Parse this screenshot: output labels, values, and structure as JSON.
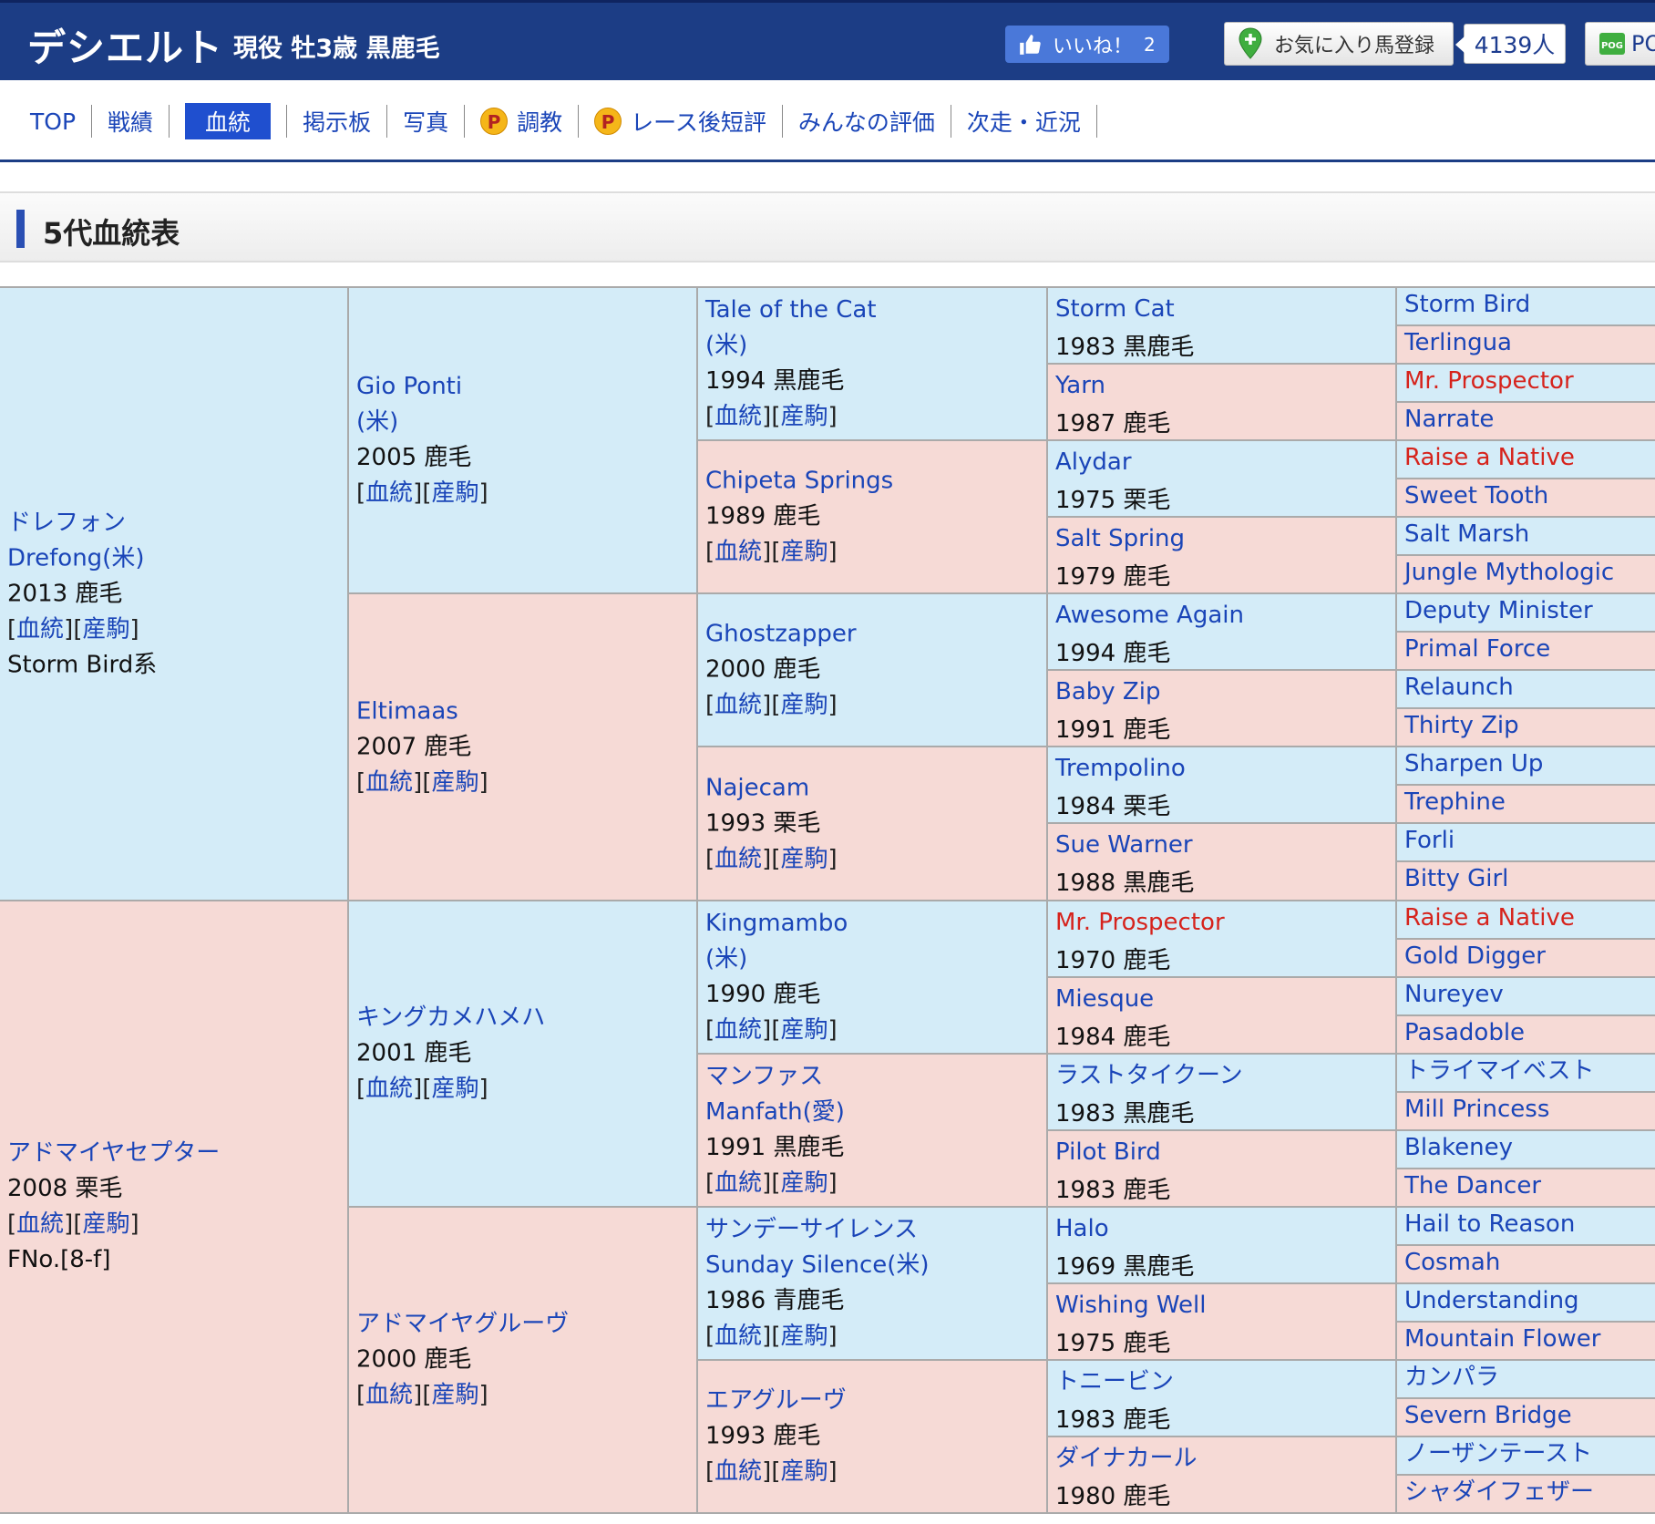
{
  "header": {
    "horse_name": "デシエルト",
    "horse_info": "現役 牡3歳 黒鹿毛",
    "like_label": "いいね！",
    "like_count": "2",
    "favorite_label": "お気に入り馬登録",
    "favorite_count": "4139人",
    "pog_label": "PO"
  },
  "nav": {
    "items": [
      {
        "label": "TOP"
      },
      {
        "label": "戦績"
      },
      {
        "label": "血統"
      },
      {
        "label": "掲示板"
      },
      {
        "label": "写真"
      },
      {
        "label": "調教",
        "p_icon": "P"
      },
      {
        "label": "レース後短評",
        "p_icon": "P"
      },
      {
        "label": "みんなの評価"
      },
      {
        "label": "次走・近況"
      }
    ]
  },
  "section": {
    "title": "5代血統表"
  },
  "link_labels": {
    "pedigree": "血統",
    "offspring": "産駒"
  },
  "pedigree": {
    "g1": [
      {
        "name": "ドレフォン",
        "name2": "Drefong(米)",
        "info": "2013 鹿毛",
        "extra": "Storm Bird系",
        "sex": "male"
      },
      {
        "name": "アドマイヤセプター",
        "info": "2008 栗毛",
        "extra": "FNo.[8-f]",
        "sex": "female"
      }
    ],
    "g2": [
      {
        "name": "Gio Ponti",
        "name2": "(米)",
        "info": "2005 鹿毛",
        "sex": "male"
      },
      {
        "name": "Eltimaas",
        "info": "2007 鹿毛",
        "sex": "female"
      },
      {
        "name": "キングカメハメハ",
        "info": "2001 鹿毛",
        "sex": "male"
      },
      {
        "name": "アドマイヤグルーヴ",
        "info": "2000 鹿毛",
        "sex": "female"
      }
    ],
    "g3": [
      {
        "name": "Tale of the Cat",
        "name2": "(米)",
        "info": "1994 黒鹿毛",
        "sex": "male"
      },
      {
        "name": "Chipeta Springs",
        "info": "1989 鹿毛",
        "sex": "female"
      },
      {
        "name": "Ghostzapper",
        "info": "2000 鹿毛",
        "sex": "male"
      },
      {
        "name": "Najecam",
        "info": "1993 栗毛",
        "sex": "female"
      },
      {
        "name": "Kingmambo",
        "name2": "(米)",
        "info": "1990 鹿毛",
        "sex": "male"
      },
      {
        "name": "マンファス",
        "name2": "Manfath(愛)",
        "info": "1991 黒鹿毛",
        "sex": "female"
      },
      {
        "name": "サンデーサイレンス",
        "name2": "Sunday Silence(米)",
        "info": "1986 青鹿毛",
        "sex": "male"
      },
      {
        "name": "エアグルーヴ",
        "info": "1993 鹿毛",
        "sex": "female"
      }
    ],
    "g4": [
      {
        "name": "Storm Cat",
        "info": "1983 黒鹿毛",
        "sex": "male"
      },
      {
        "name": "Yarn",
        "info": "1987 鹿毛",
        "sex": "female"
      },
      {
        "name": "Alydar",
        "info": "1975 栗毛",
        "sex": "male"
      },
      {
        "name": "Salt Spring",
        "info": "1979 鹿毛",
        "sex": "female"
      },
      {
        "name": "Awesome Again",
        "info": "1994 鹿毛",
        "sex": "male"
      },
      {
        "name": "Baby Zip",
        "info": "1991 鹿毛",
        "sex": "female"
      },
      {
        "name": "Trempolino",
        "info": "1984 栗毛",
        "sex": "male"
      },
      {
        "name": "Sue Warner",
        "info": "1988 黒鹿毛",
        "sex": "female"
      },
      {
        "name": "Mr. Prospector",
        "info": "1970 鹿毛",
        "sex": "male",
        "red": true
      },
      {
        "name": "Miesque",
        "info": "1984 鹿毛",
        "sex": "female"
      },
      {
        "name": "ラストタイクーン",
        "info": "1983 黒鹿毛",
        "sex": "male"
      },
      {
        "name": "Pilot Bird",
        "info": "1983 鹿毛",
        "sex": "female"
      },
      {
        "name": "Halo",
        "info": "1969 黒鹿毛",
        "sex": "male"
      },
      {
        "name": "Wishing Well",
        "info": "1975 鹿毛",
        "sex": "female"
      },
      {
        "name": "トニービン",
        "info": "1983 鹿毛",
        "sex": "male"
      },
      {
        "name": "ダイナカール",
        "info": "1980 鹿毛",
        "sex": "female"
      }
    ],
    "g5": [
      {
        "name": "Storm Bird",
        "sex": "male"
      },
      {
        "name": "Terlingua",
        "sex": "female"
      },
      {
        "name": "Mr. Prospector",
        "sex": "male",
        "red": true
      },
      {
        "name": "Narrate",
        "sex": "female"
      },
      {
        "name": "Raise a Native",
        "sex": "male",
        "red": true
      },
      {
        "name": "Sweet Tooth",
        "sex": "female"
      },
      {
        "name": "Salt Marsh",
        "sex": "male"
      },
      {
        "name": "Jungle Mythologic",
        "sex": "female"
      },
      {
        "name": "Deputy Minister",
        "sex": "male"
      },
      {
        "name": "Primal Force",
        "sex": "female"
      },
      {
        "name": "Relaunch",
        "sex": "male"
      },
      {
        "name": "Thirty Zip",
        "sex": "female"
      },
      {
        "name": "Sharpen Up",
        "sex": "male"
      },
      {
        "name": "Trephine",
        "sex": "female"
      },
      {
        "name": "Forli",
        "sex": "male"
      },
      {
        "name": "Bitty Girl",
        "sex": "female"
      },
      {
        "name": "Raise a Native",
        "sex": "male",
        "red": true
      },
      {
        "name": "Gold Digger",
        "sex": "female"
      },
      {
        "name": "Nureyev",
        "sex": "male"
      },
      {
        "name": "Pasadoble",
        "sex": "female"
      },
      {
        "name": "トライマイベスト",
        "sex": "male"
      },
      {
        "name": "Mill Princess",
        "sex": "female"
      },
      {
        "name": "Blakeney",
        "sex": "male"
      },
      {
        "name": "The Dancer",
        "sex": "female"
      },
      {
        "name": "Hail to Reason",
        "sex": "male"
      },
      {
        "name": "Cosmah",
        "sex": "female"
      },
      {
        "name": "Understanding",
        "sex": "male"
      },
      {
        "name": "Mountain Flower",
        "sex": "female"
      },
      {
        "name": "カンパラ",
        "sex": "male"
      },
      {
        "name": "Severn Bridge",
        "sex": "female"
      },
      {
        "name": "ノーザンテースト",
        "sex": "male"
      },
      {
        "name": "シャダイフェザー",
        "sex": "female"
      }
    ]
  },
  "colors": {
    "header_bg": "#1c3d85",
    "link": "#1a45b8",
    "red_name": "#d6231c",
    "male_bg": "#d4ecf8",
    "female_bg": "#f6dad6"
  },
  "icons": {
    "like": "thumbs-up-icon",
    "favorite": "pin-plus-icon",
    "pog": "pog-icon"
  }
}
